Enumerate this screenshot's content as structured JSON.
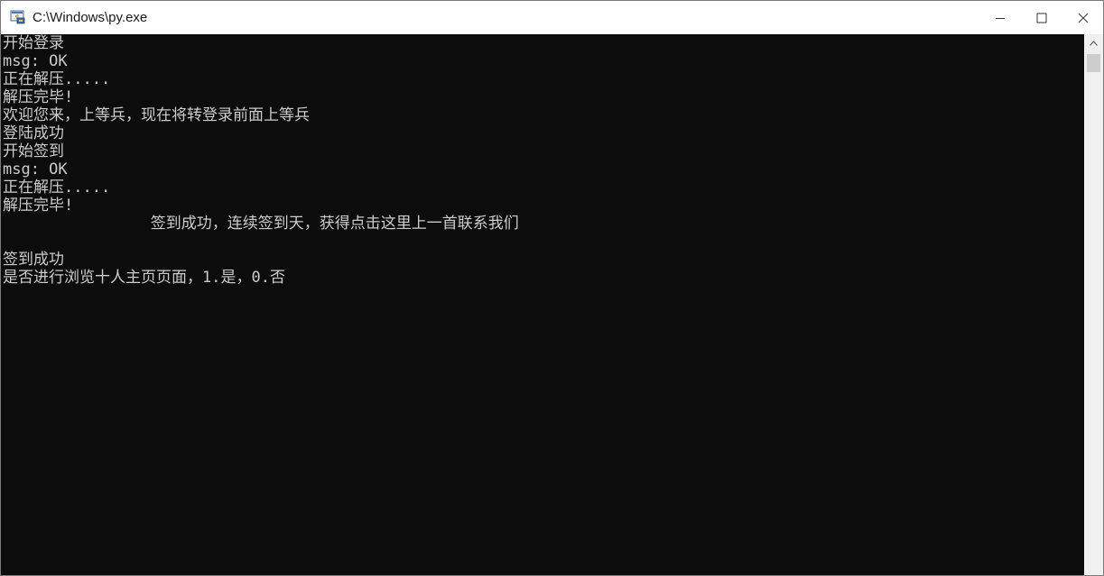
{
  "window": {
    "title": "C:\\Windows\\py.exe",
    "icon": "python-console-icon",
    "buttons": {
      "minimize": "minimize-icon",
      "maximize": "maximize-icon",
      "close": "close-icon"
    }
  },
  "console": {
    "background": "#0c0c0c",
    "foreground": "#cccccc",
    "lines": [
      "开始登录",
      "msg: OK",
      "正在解压.....",
      "解压完毕!",
      "欢迎您来，上等兵，现在将转登录前面上等兵",
      "登陆成功",
      "开始签到",
      "msg: OK",
      "正在解压.....",
      "解压完毕!",
      "                签到成功，连续签到天，获得点击这里上一首联系我们",
      "",
      "签到成功",
      "是否进行浏览十人主页页面，1.是，0.否"
    ]
  },
  "scrollbar": {
    "up_arrow": "chevron-up-icon"
  }
}
